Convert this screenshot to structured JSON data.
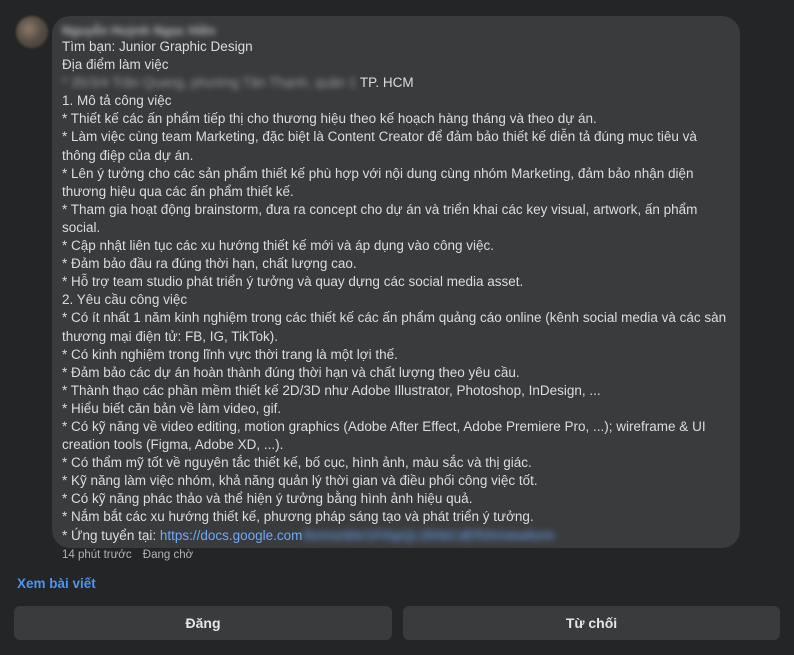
{
  "message": {
    "author": "Nguyễn Huỳnh Ngọc Hiền",
    "lines": {
      "l1": "Tìm bạn: Junior Graphic Design",
      "l2": "Địa điểm làm việc",
      "addr_blur": "* 35/3/4 Trần Quang, phường Tân Thạnh, quận 1",
      "addr_city": " TP. HCM",
      "l4": "1. Mô tả công việc",
      "l5": "* Thiết kế các ấn phẩm tiếp thị cho thương hiệu theo kế hoạch hàng tháng và theo dự án.",
      "l6": "* Làm việc cùng team Marketing, đặc biệt là Content Creator để đảm bảo thiết kế diễn tả đúng mục tiêu và",
      "l7": "thông điệp của dự án.",
      "l8": "* Lên ý tưởng cho các sản phẩm thiết kế phù hợp với nội dung cùng nhóm Marketing, đảm bảo nhận diện",
      "l9": "thương hiệu qua các ấn phẩm thiết kế.",
      "l10": "* Tham gia hoạt động brainstorm, đưa ra concept cho dự án và triển khai các key visual, artwork, ấn phẩm",
      "l11": "social.",
      "l12": "* Cập nhật liên tục các xu hướng thiết kế mới và áp dụng vào công việc.",
      "l13": "* Đảm bảo đầu ra đúng thời hạn, chất lượng cao.",
      "l14": "* Hỗ trợ team studio phát triển ý tưởng và quay dựng các social media asset.",
      "l15": "2. Yêu cầu công việc",
      "l16": "* Có ít nhất 1 năm kinh nghiệm trong các thiết kế các ấn phẩm quảng cáo online (kênh social media và các sàn",
      "l17": "thương mại điện tử: FB, IG, TikTok).",
      "l18": "* Có kinh nghiệm trong lĩnh vực thời trang là một lợi thế.",
      "l19": "* Đảm bảo các dự án hoàn thành đúng thời hạn và chất lượng theo yêu cầu.",
      "l20": "* Thành thạo các phần mềm thiết kế 2D/3D như Adobe Illustrator, Photoshop, InDesign, ...",
      "l21": "* Hiểu biết căn bản về làm video, gif.",
      "l22": "* Có kỹ năng về video editing, motion graphics (Adobe After Effect, Adobe Premiere Pro, ...); wireframe & UI",
      "l23": "creation tools (Figma, Adobe XD, ...).",
      "l24": "* Có thẩm mỹ tốt về nguyên tắc thiết kế, bố cục, hình ảnh, màu sắc và thị giác.",
      "l25": "* Kỹ năng làm việc nhóm, khả năng quản lý thời gian và điều phối công việc tốt.",
      "l26": "* Có kỹ năng phác thảo và thể hiện ý tưởng bằng hình ảnh hiệu quả.",
      "l27": "* Nắm bắt các xu hướng thiết kế, phương pháp sáng tạo và phát triển ý tưởng.",
      "apply_prefix": "* Ứng tuyển tại: ",
      "apply_link": "https://docs.google.com",
      "apply_link_rest": "/forms/d/e/1FAIpQLSfAbCdEfGh/viewform"
    }
  },
  "meta": {
    "time": "14 phút trước",
    "status": "Đang chờ"
  },
  "actions": {
    "view_post": "Xem bài viết",
    "post": "Đăng",
    "reject": "Từ chối"
  }
}
